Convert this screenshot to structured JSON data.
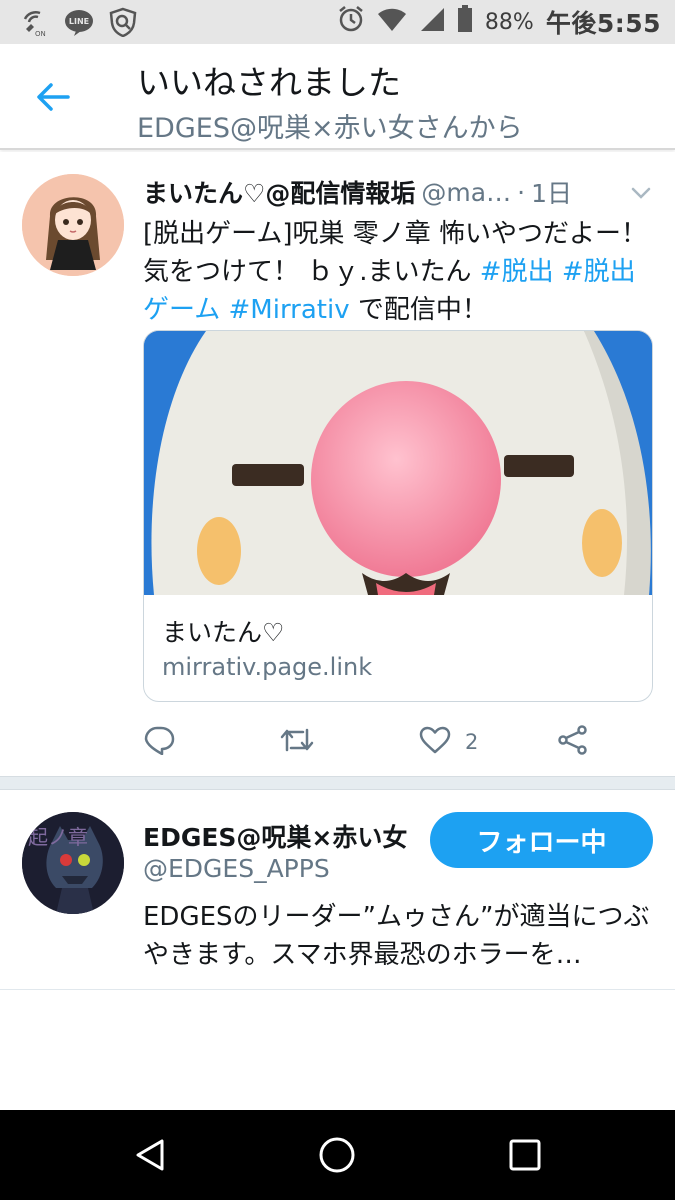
{
  "status_bar": {
    "icons": [
      "wifi-calling-on-icon",
      "line-app-icon",
      "shield-icon"
    ],
    "right_icons": [
      "alarm-icon",
      "wifi-icon",
      "cell-signal-icon",
      "battery-icon"
    ],
    "wifi_label": "ON",
    "line_label": "LINE",
    "battery_percent": "88%",
    "time": "午後5:55"
  },
  "header": {
    "title": "いいねされました",
    "subtitle": "EDGES@呪巣×赤い女さんから"
  },
  "tweet": {
    "author_name": "まいたん♡@配信情報垢",
    "author_handle": "@ma…",
    "separator": "·",
    "time": "1日",
    "text_before": "[脱出ゲーム]呪巣 零ノ章 怖いやつだよー！気をつけて！ ｂｙ.まいたん ",
    "hashtag1": "#脱出",
    "hashtag2": "#脱出ゲーム",
    "hashtag3": "#Mirrativ",
    "text_after": " で配信中！",
    "card": {
      "title": "まいたん♡",
      "url": "mirrativ.page.link"
    },
    "actions": {
      "like_count": "2"
    }
  },
  "user": {
    "name": "EDGES@呪巣×赤い女",
    "handle": "@EDGES_APPS",
    "follow_label": "フォロー中",
    "bio": "EDGESのリーダー”ムゥさん”が適当につぶやきます。スマホ界最恐のホラーを…",
    "avatar_text": "起ノ章"
  },
  "colors": {
    "accent": "#1da1f2",
    "secondary_text": "#657786",
    "status_bar_bg": "#e6e6e6",
    "nav_bar_bg": "#000000"
  }
}
